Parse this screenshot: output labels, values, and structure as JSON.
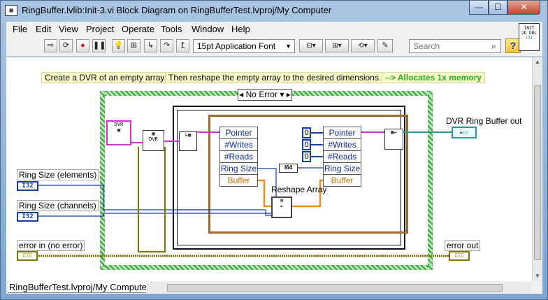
{
  "window": {
    "title": "RingBuffer.lvlib:Init-3.vi Block Diagram on RingBufferTest.lvproj/My Computer",
    "min_label": "—",
    "max_label": "☐",
    "close_label": "✕"
  },
  "menu": [
    "File",
    "Edit",
    "View",
    "Project",
    "Operate",
    "Tools",
    "Window",
    "Help"
  ],
  "toolbar": {
    "font": "15pt Application Font",
    "search_placeholder": "Search",
    "help_label": "?"
  },
  "connector_icon": {
    "line1": "INIT",
    "line2": "2D DBL",
    "line3": "(3)"
  },
  "notes": {
    "n1": "Create a DVR of an empty array.",
    "n2": "Then reshape the empty array to the desired dimensions.",
    "n3": "--> Allocates 1x memory"
  },
  "case_selector": "No Error",
  "bundle_left": [
    "Pointer",
    "#Writes",
    "#Reads",
    "Ring Size",
    "Buffer"
  ],
  "bundle_right": [
    "Pointer",
    "#Writes",
    "#Reads",
    "Ring Size",
    "Buffer"
  ],
  "constants": [
    "0",
    "0",
    "0"
  ],
  "i64_label": "I64",
  "reshape_label": "Reshape Array",
  "controls": {
    "ring_size_elements": "Ring Size (elements)",
    "ring_size_channels": "Ring Size (channels)",
    "error_in": "error in (no error)",
    "i32": "I32"
  },
  "indicators": {
    "dvr_out": "DVR Ring Buffer out",
    "error_out": "error out"
  },
  "status": {
    "project": "RingBufferTest.lvproj/My Computer"
  },
  "colors": {
    "case_border": "#3aa23a",
    "wire_blue": "#143fa8",
    "wire_orange": "#e7901f",
    "wire_pink": "#d62fd6",
    "error_wire": "#807400"
  }
}
